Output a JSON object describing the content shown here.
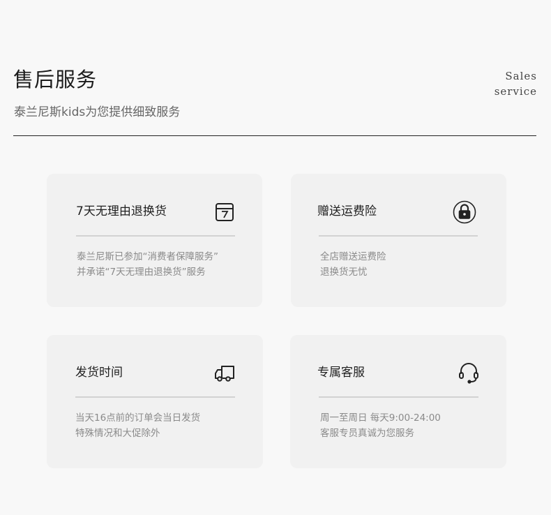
{
  "header": {
    "title": "售后服务",
    "subtitle": "泰兰尼斯kids为您提供细致服务",
    "en_line1": "Sales",
    "en_line2": "service"
  },
  "cards": [
    {
      "title": "7天无理由退换货",
      "icon": "calendar-seven-icon",
      "line1": "泰兰尼斯已参加“消费者保障服务”",
      "line2": "并承诺“7天无理由退换货”服务"
    },
    {
      "title": "赠送运费险",
      "icon": "lock-icon",
      "line1": "全店赠送运费险",
      "line2": "退换货无忧"
    },
    {
      "title": "发货时间",
      "icon": "delivery-truck-icon",
      "line1": "当天16点前的订单会当日发货",
      "line2": "特殊情况和大促除外"
    },
    {
      "title": "专属客服",
      "icon": "headset-icon",
      "line1": "周一至周日  每天9:00-24:00",
      "line2": "客服专员真诚为您服务"
    }
  ],
  "colors": {
    "background": "#f8f8f8",
    "card": "#f1f1f1",
    "rule": "#222222",
    "muted_text": "#8a8a8a"
  }
}
